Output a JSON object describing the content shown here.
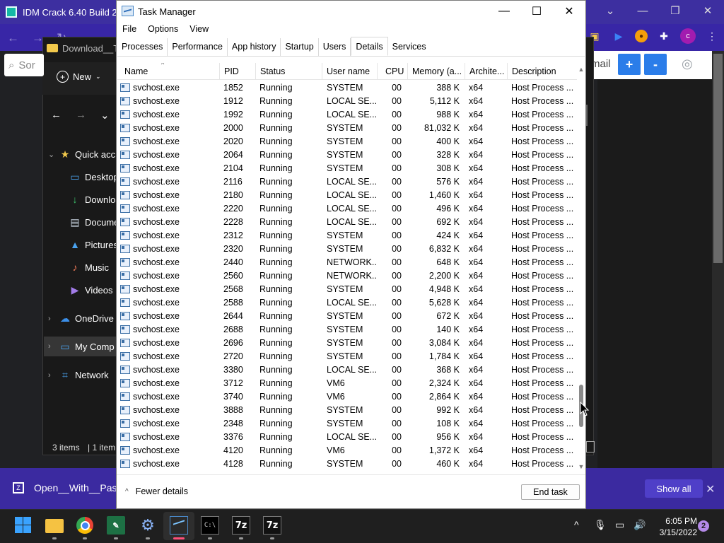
{
  "browser": {
    "tab_title": "IDM Crack 6.40 Build 2",
    "email_text": "mail",
    "plus_label": "+",
    "minus_label": "-"
  },
  "explorer": {
    "title": "Download__T",
    "new_label": "New",
    "search_placeholder": "Sor",
    "tree": [
      {
        "label": "Quick acc",
        "icon": "star-icon"
      },
      {
        "label": "Desktop",
        "icon": "desktop-icon"
      },
      {
        "label": "Downloa",
        "icon": "download-icon"
      },
      {
        "label": "Docume",
        "icon": "document-icon"
      },
      {
        "label": "Pictures",
        "icon": "pictures-icon"
      },
      {
        "label": "Music",
        "icon": "music-icon"
      },
      {
        "label": "Videos",
        "icon": "videos-icon"
      },
      {
        "label": "OneDrive",
        "icon": "cloud-icon"
      },
      {
        "label": "My Comp",
        "icon": "computer-icon"
      },
      {
        "label": "Network",
        "icon": "network-icon"
      }
    ],
    "status_items": "3 items",
    "status_selected": "1 item"
  },
  "notification": {
    "file_name": "Open__With__Pas...",
    "show_all": "Show all"
  },
  "task_manager": {
    "title": "Task Manager",
    "menu": [
      "File",
      "Options",
      "View"
    ],
    "tabs": [
      "Processes",
      "Performance",
      "App history",
      "Startup",
      "Users",
      "Details",
      "Services"
    ],
    "active_tab": "Details",
    "columns": [
      "Name",
      "PID",
      "Status",
      "User name",
      "CPU",
      "Memory (a...",
      "Archite...",
      "Description"
    ],
    "rows": [
      [
        "svchost.exe",
        "1852",
        "Running",
        "SYSTEM",
        "00",
        "388 K",
        "x64",
        "Host Process ..."
      ],
      [
        "svchost.exe",
        "1912",
        "Running",
        "LOCAL SE...",
        "00",
        "5,112 K",
        "x64",
        "Host Process ..."
      ],
      [
        "svchost.exe",
        "1992",
        "Running",
        "LOCAL SE...",
        "00",
        "988 K",
        "x64",
        "Host Process ..."
      ],
      [
        "svchost.exe",
        "2000",
        "Running",
        "SYSTEM",
        "00",
        "81,032 K",
        "x64",
        "Host Process ..."
      ],
      [
        "svchost.exe",
        "2020",
        "Running",
        "SYSTEM",
        "00",
        "400 K",
        "x64",
        "Host Process ..."
      ],
      [
        "svchost.exe",
        "2064",
        "Running",
        "SYSTEM",
        "00",
        "328 K",
        "x64",
        "Host Process ..."
      ],
      [
        "svchost.exe",
        "2104",
        "Running",
        "SYSTEM",
        "00",
        "308 K",
        "x64",
        "Host Process ..."
      ],
      [
        "svchost.exe",
        "2116",
        "Running",
        "LOCAL SE...",
        "00",
        "576 K",
        "x64",
        "Host Process ..."
      ],
      [
        "svchost.exe",
        "2180",
        "Running",
        "LOCAL SE...",
        "00",
        "1,460 K",
        "x64",
        "Host Process ..."
      ],
      [
        "svchost.exe",
        "2220",
        "Running",
        "LOCAL SE...",
        "00",
        "496 K",
        "x64",
        "Host Process ..."
      ],
      [
        "svchost.exe",
        "2228",
        "Running",
        "LOCAL SE...",
        "00",
        "692 K",
        "x64",
        "Host Process ..."
      ],
      [
        "svchost.exe",
        "2312",
        "Running",
        "SYSTEM",
        "00",
        "424 K",
        "x64",
        "Host Process ..."
      ],
      [
        "svchost.exe",
        "2320",
        "Running",
        "SYSTEM",
        "00",
        "6,832 K",
        "x64",
        "Host Process ..."
      ],
      [
        "svchost.exe",
        "2440",
        "Running",
        "NETWORK...",
        "00",
        "648 K",
        "x64",
        "Host Process ..."
      ],
      [
        "svchost.exe",
        "2560",
        "Running",
        "NETWORK...",
        "00",
        "2,200 K",
        "x64",
        "Host Process ..."
      ],
      [
        "svchost.exe",
        "2568",
        "Running",
        "SYSTEM",
        "00",
        "4,948 K",
        "x64",
        "Host Process ..."
      ],
      [
        "svchost.exe",
        "2588",
        "Running",
        "LOCAL SE...",
        "00",
        "5,628 K",
        "x64",
        "Host Process ..."
      ],
      [
        "svchost.exe",
        "2644",
        "Running",
        "SYSTEM",
        "00",
        "672 K",
        "x64",
        "Host Process ..."
      ],
      [
        "svchost.exe",
        "2688",
        "Running",
        "SYSTEM",
        "00",
        "140 K",
        "x64",
        "Host Process ..."
      ],
      [
        "svchost.exe",
        "2696",
        "Running",
        "SYSTEM",
        "00",
        "3,084 K",
        "x64",
        "Host Process ..."
      ],
      [
        "svchost.exe",
        "2720",
        "Running",
        "SYSTEM",
        "00",
        "1,784 K",
        "x64",
        "Host Process ..."
      ],
      [
        "svchost.exe",
        "3380",
        "Running",
        "LOCAL SE...",
        "00",
        "368 K",
        "x64",
        "Host Process ..."
      ],
      [
        "svchost.exe",
        "3712",
        "Running",
        "VM6",
        "00",
        "2,324 K",
        "x64",
        "Host Process ..."
      ],
      [
        "svchost.exe",
        "3740",
        "Running",
        "VM6",
        "00",
        "2,864 K",
        "x64",
        "Host Process ..."
      ],
      [
        "svchost.exe",
        "3888",
        "Running",
        "SYSTEM",
        "00",
        "992 K",
        "x64",
        "Host Process ..."
      ],
      [
        "svchost.exe",
        "2348",
        "Running",
        "SYSTEM",
        "00",
        "108 K",
        "x64",
        "Host Process ..."
      ],
      [
        "svchost.exe",
        "3376",
        "Running",
        "LOCAL SE...",
        "00",
        "956 K",
        "x64",
        "Host Process ..."
      ],
      [
        "svchost.exe",
        "4120",
        "Running",
        "VM6",
        "00",
        "1,372 K",
        "x64",
        "Host Process ..."
      ],
      [
        "svchost.exe",
        "4128",
        "Running",
        "SYSTEM",
        "00",
        "460 K",
        "x64",
        "Host Process ..."
      ]
    ],
    "fewer_details": "Fewer details",
    "end_task": "End task"
  },
  "taskbar": {
    "time": "6:05 PM",
    "date": "3/15/2022",
    "notification_count": "2",
    "apps": [
      "start-icon",
      "file-explorer-icon",
      "chrome-icon",
      "excel-icon",
      "settings-icon",
      "task-manager-icon",
      "terminal-icon",
      "7zip-icon",
      "7zip-icon"
    ]
  },
  "colors": {
    "browser_purple": "#3d2fa0",
    "accent_blue": "#2b7de9",
    "taskbar_active": "#ff4f7a"
  }
}
